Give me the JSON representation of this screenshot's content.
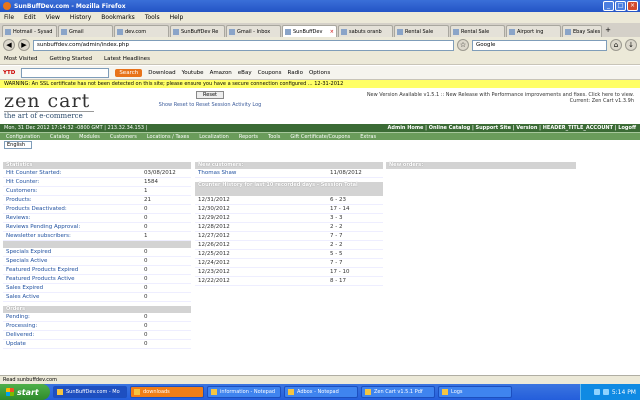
{
  "window": {
    "title": "SunBuffDev.com - Mozilla Firefox"
  },
  "menu": [
    "File",
    "Edit",
    "View",
    "History",
    "Bookmarks",
    "Tools",
    "Help"
  ],
  "tabs": [
    {
      "label": "Hotmail - Sysad"
    },
    {
      "label": "Gmail"
    },
    {
      "label": "dev.com"
    },
    {
      "label": "SunBuffDev Re"
    },
    {
      "label": "Gmail - Inbox"
    },
    {
      "label": "SunBuffDev",
      "active": true
    },
    {
      "label": "sabuts oranb"
    },
    {
      "label": "Rental Sale"
    },
    {
      "label": "Rental Sale"
    },
    {
      "label": "Airport ing"
    },
    {
      "label": "Ebay Sales"
    }
  ],
  "nav": {
    "url": "sunbuffdev.com/admin/index.php",
    "search": "Google"
  },
  "bookmarks": [
    "Most Visited",
    "Getting Started",
    "Latest Headlines"
  ],
  "toolbar2": {
    "brand": "YTD",
    "search": "",
    "go": "Search",
    "items": [
      "Download",
      "Youtube",
      "Amazon",
      "eBay",
      "Coupons",
      "Radio",
      "Options"
    ]
  },
  "notice": "WARNING: An SSL certificate has not been detected on this site; please ensure you have a secure connection configured ... 12-31-2012",
  "logo": {
    "name": "zen cart",
    "tagline": "the art of e-commerce"
  },
  "header": {
    "reset": "Reset",
    "note": "Show Reset to Reset Session Activity Log",
    "right": "New Version Available v1.5.1 :: New Release with Performance improvements and fixes. Click here to view. Current: Zen Cart v1.3.9h"
  },
  "greenbar": {
    "left": "Mon, 31 Dec 2012 17:14:32 -0800 GMT | 213.32.34.153 |",
    "right": "Admin Home | Online Catalog | Support Site | Version | HEADER_TITLE_ACCOUNT | Logoff"
  },
  "adminmenu": [
    "Configuration",
    "Catalog",
    "Modules",
    "Customers",
    "Locations / Taxes",
    "Localization",
    "Reports",
    "Tools",
    "Gift Certificate/Coupons",
    "Extras"
  ],
  "language": "English",
  "statistics": {
    "header": "Statistics",
    "rows": [
      {
        "k": "Hit Counter Started:",
        "v": "03/08/2012"
      },
      {
        "k": "Hit Counter:",
        "v": "1584"
      },
      {
        "k": "Customers:",
        "v": "1"
      },
      {
        "k": "Products:",
        "v": "21"
      },
      {
        "k": "Products Deactivated:",
        "v": "0"
      },
      {
        "k": "Reviews:",
        "v": "0"
      },
      {
        "k": "Reviews Pending Approval:",
        "v": "0"
      },
      {
        "k": "Newsletter subscribers:",
        "v": "1"
      }
    ],
    "rows2": [
      {
        "k": "Specials Expired",
        "v": "0"
      },
      {
        "k": "Specials Active",
        "v": "0"
      },
      {
        "k": "Featured Products Expired",
        "v": "0"
      },
      {
        "k": "Featured Products Active",
        "v": "0"
      },
      {
        "k": "Sales Expired",
        "v": "0"
      },
      {
        "k": "Sales Active",
        "v": "0"
      }
    ]
  },
  "orders": {
    "header": "Orders",
    "rows": [
      {
        "k": "Pending:",
        "v": "0"
      },
      {
        "k": "Processing:",
        "v": "0"
      },
      {
        "k": "Delivered:",
        "v": "0"
      },
      {
        "k": "Update",
        "v": "0"
      }
    ]
  },
  "customers": {
    "header": "New customers:",
    "rows": [
      {
        "k": "Thomas Shaw",
        "v": "11/08/2012"
      }
    ]
  },
  "counter": {
    "header": "Counter History for last 10 recorded days - Session Total",
    "rows": [
      {
        "k": "12/31/2012",
        "v": "6 - 23"
      },
      {
        "k": "12/30/2012",
        "v": "17 - 14"
      },
      {
        "k": "12/29/2012",
        "v": "3 - 3"
      },
      {
        "k": "12/28/2012",
        "v": "2 - 2"
      },
      {
        "k": "12/27/2012",
        "v": "7 - 7"
      },
      {
        "k": "12/26/2012",
        "v": "2 - 2"
      },
      {
        "k": "12/25/2012",
        "v": "5 - 5"
      },
      {
        "k": "12/24/2012",
        "v": "7 - 7"
      },
      {
        "k": "12/23/2012",
        "v": "17 - 10"
      },
      {
        "k": "12/22/2012",
        "v": "8 - 17"
      }
    ]
  },
  "neworders": {
    "header": "New orders:"
  },
  "status": "Read sunbuffdev.com",
  "taskbar": {
    "start": "start",
    "items": [
      {
        "label": "SunBuffDev.com - Mo",
        "active": true
      },
      {
        "label": "downloads",
        "orange": true
      },
      {
        "label": "information - Notepad"
      },
      {
        "label": "Adbox - Notepad"
      },
      {
        "label": "Zen Cart v1.5.1 Pdf"
      },
      {
        "label": "Logs"
      }
    ],
    "clock": "5:14 PM"
  }
}
